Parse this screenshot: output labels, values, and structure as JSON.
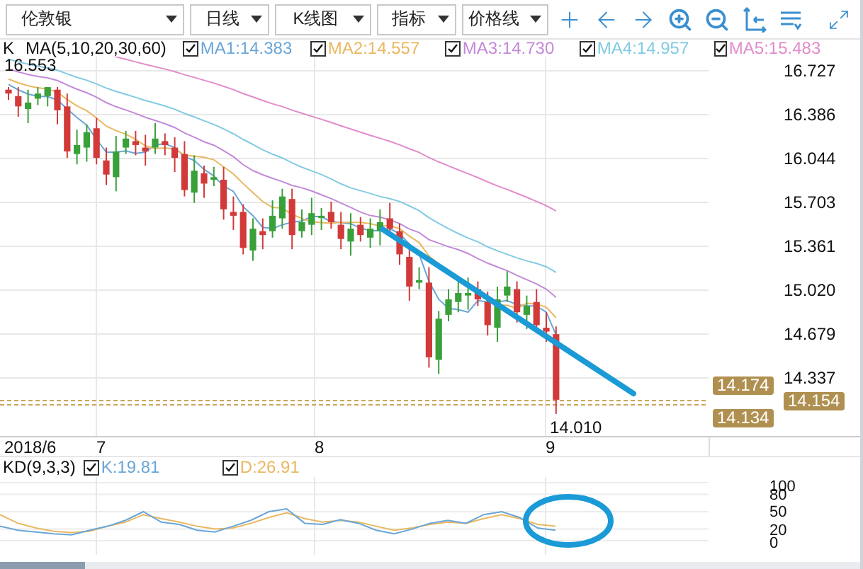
{
  "toolbar": {
    "dropdowns": [
      {
        "label": "伦敦银"
      },
      {
        "label": "日线"
      },
      {
        "label": "K线图"
      },
      {
        "label": "指标"
      },
      {
        "label": "价格线"
      }
    ]
  },
  "legend": {
    "label": "K",
    "formula": "MA(5,10,20,30,60)",
    "items": [
      {
        "label": "MA1:14.383",
        "checked": true,
        "color": "#6aa6d8"
      },
      {
        "label": "MA2:14.557",
        "checked": true,
        "color": "#e9b860"
      },
      {
        "label": "MA3:14.730",
        "checked": true,
        "color": "#c38ad8"
      },
      {
        "label": "MA4:14.957",
        "checked": true,
        "color": "#82cbe3"
      },
      {
        "label": "MA5:15.483",
        "checked": true,
        "color": "#e28ccb"
      }
    ]
  },
  "price_chart": {
    "high_label": "16.553",
    "low_label": "14.010",
    "axis_labels": [
      "16.727",
      "16.386",
      "16.044",
      "15.703",
      "15.361",
      "15.020",
      "14.679",
      "14.337"
    ],
    "badges": [
      {
        "text": "14.174",
        "kind": "upper"
      },
      {
        "text": "14.154",
        "kind": "current"
      },
      {
        "text": "14.134",
        "kind": "lower"
      }
    ]
  },
  "dates": [
    "2018/6",
    "7",
    "8",
    "9"
  ],
  "kd": {
    "label": "KD(9,3,3)",
    "items": [
      {
        "label": "K:19.81",
        "checked": true,
        "color": "#6aa6d8"
      },
      {
        "label": "D:26.91",
        "checked": true,
        "color": "#e9b860"
      }
    ],
    "axis_labels": [
      "100",
      "80",
      "50",
      "20",
      "0"
    ]
  }
}
